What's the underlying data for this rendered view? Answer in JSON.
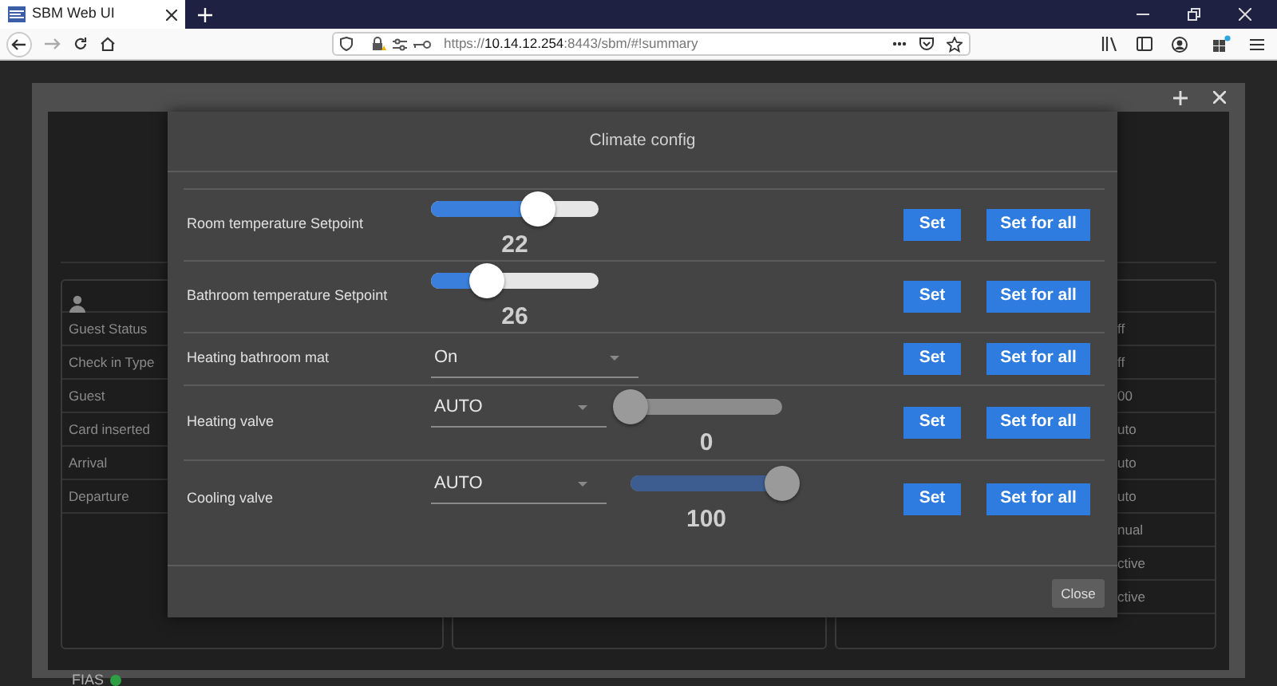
{
  "browser": {
    "tab_title": "SBM Web UI",
    "url": {
      "scheme": "https://",
      "host": "10.14.12.254",
      "rest": ":8443/sbm/#!summary"
    }
  },
  "background": {
    "guest_labels": [
      "Guest Status",
      "Check in Type",
      "Guest",
      "Card inserted",
      "Arrival",
      "Departure"
    ],
    "right_values": [
      "ff",
      "ff",
      "00",
      "uto",
      "uto",
      "uto",
      "nual",
      "ctive",
      "ctive"
    ],
    "status_label": "FIAS"
  },
  "dialog": {
    "title": "Climate config",
    "rows": [
      {
        "label": "Room temperature Setpoint",
        "kind": "slider",
        "level": 0.64,
        "reading": "22",
        "disabled": false,
        "buttons": [
          "Set",
          "Set for all"
        ]
      },
      {
        "label": "Bathroom temperature Setpoint",
        "kind": "slider",
        "level": 0.33,
        "reading": "26",
        "disabled": false,
        "buttons": [
          "Set",
          "Set for all"
        ]
      },
      {
        "label": "Heating bathroom mat",
        "kind": "select",
        "value": "On",
        "buttons": [
          "Set",
          "Set for all"
        ]
      },
      {
        "label": "Heating valve",
        "kind": "select-slider",
        "value": "AUTO",
        "level": 0,
        "reading": "0",
        "disabled": true,
        "buttons": [
          "Set",
          "Set for all"
        ]
      },
      {
        "label": "Cooling valve",
        "kind": "select-slider",
        "value": "AUTO",
        "level": 1,
        "reading": "100",
        "disabled": true,
        "buttons": [
          "Set",
          "Set for all"
        ]
      }
    ],
    "close_label": "Close"
  }
}
